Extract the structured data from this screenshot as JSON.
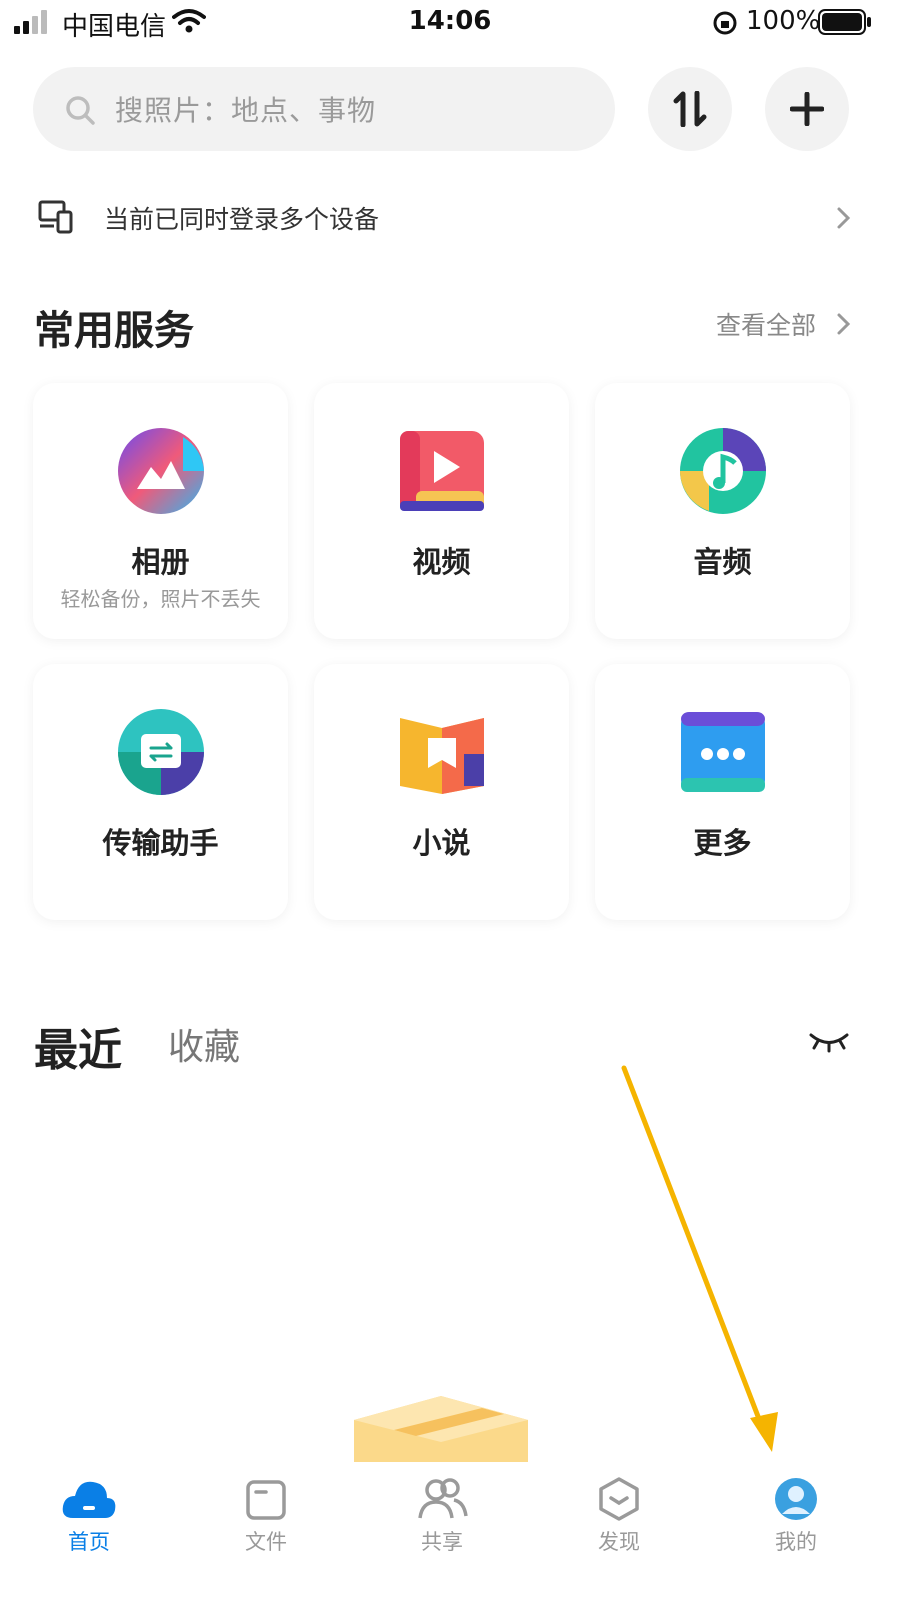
{
  "status_bar": {
    "carrier": "中国电信",
    "time": "14:06",
    "battery": "100%"
  },
  "search": {
    "placeholder": "搜照片：地点、事物"
  },
  "devices_notice": {
    "text": "当前已同时登录多个设备"
  },
  "services": {
    "title": "常用服务",
    "view_all": "查看全部",
    "items": [
      {
        "label": "相册",
        "subtitle": "轻松备份，照片不丢失",
        "icon": "album-icon"
      },
      {
        "label": "视频",
        "icon": "video-icon"
      },
      {
        "label": "音频",
        "icon": "audio-icon"
      },
      {
        "label": "传输助手",
        "icon": "transfer-icon"
      },
      {
        "label": "小说",
        "icon": "novel-icon"
      },
      {
        "label": "更多",
        "icon": "more-icon"
      }
    ]
  },
  "recent": {
    "title": "最近",
    "favorites": "收藏"
  },
  "tabbar": {
    "items": [
      {
        "label": "首页",
        "icon": "cloud-icon",
        "active": true
      },
      {
        "label": "文件",
        "icon": "folder-icon"
      },
      {
        "label": "共享",
        "icon": "people-icon"
      },
      {
        "label": "发现",
        "icon": "discover-icon"
      },
      {
        "label": "我的",
        "icon": "avatar-icon"
      }
    ]
  },
  "colors": {
    "accent": "#0a7fe6",
    "annotation_arrow": "#f5b400"
  }
}
